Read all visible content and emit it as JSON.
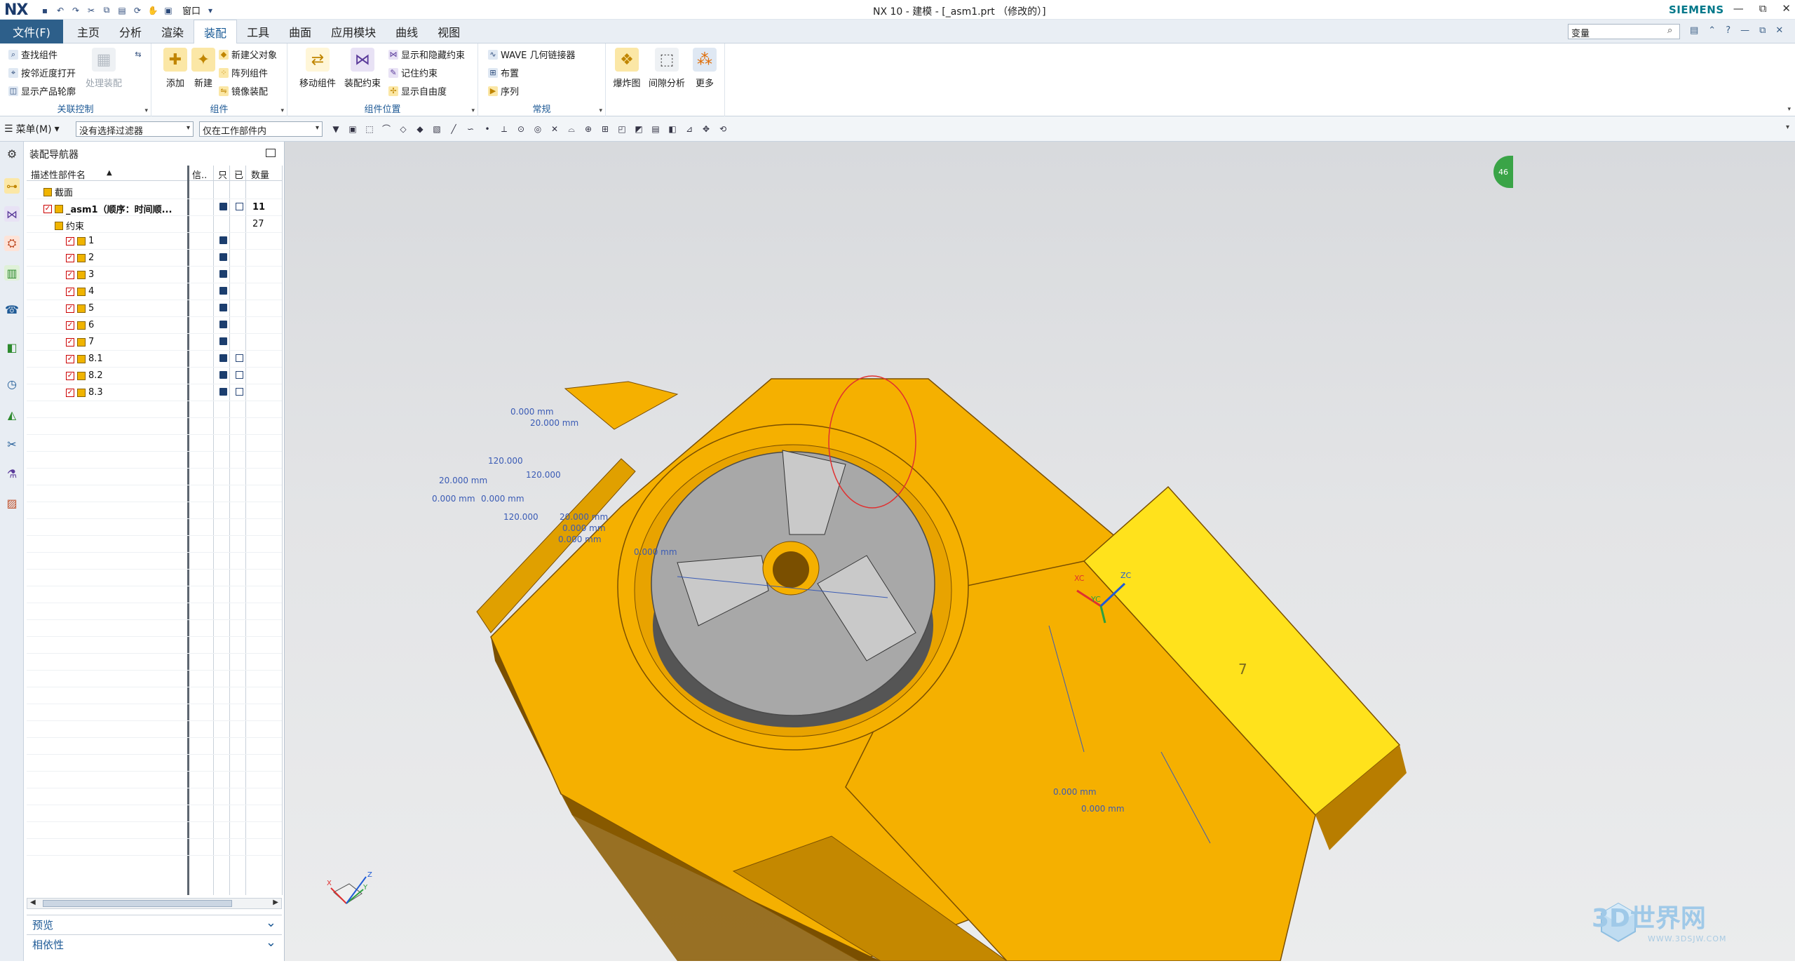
{
  "app": {
    "logo": "NX",
    "title": "NX 10 - 建模 - [_asm1.prt （修改的）]",
    "brand": "SIEMENS",
    "window_menu": "窗口",
    "window_controls": [
      "—",
      "⧉",
      "✕"
    ]
  },
  "tabs": {
    "file": "文件(F)",
    "items": [
      "主页",
      "分析",
      "渲染",
      "装配",
      "工具",
      "曲面",
      "应用模块",
      "曲线",
      "视图"
    ],
    "active": "装配",
    "search_value": "变量"
  },
  "ribbon": {
    "assoc_control": {
      "label": "关联控制",
      "cmds": [
        "查找组件",
        "按邻近度打开",
        "显示产品轮廓"
      ],
      "disabled_cmd": "处理装配"
    },
    "component": {
      "label": "组件",
      "big": [
        "添加",
        "新建"
      ],
      "cmds": [
        "新建父对象",
        "阵列组件",
        "镜像装配"
      ]
    },
    "component_position": {
      "label": "组件位置",
      "big": [
        "移动组件",
        "装配约束"
      ],
      "cmds": [
        "显示和隐藏约束",
        "记住约束",
        "显示自由度"
      ]
    },
    "general": {
      "label": "常规",
      "cmds": [
        "WAVE 几何链接器",
        "布置",
        "序列"
      ]
    },
    "more": {
      "big": [
        "爆炸图",
        "间隙分析",
        "更多"
      ]
    }
  },
  "toolbar2": {
    "menu_label": "菜单(M)",
    "filter_select": "没有选择过滤器",
    "scope_select": "仅在工作部件内"
  },
  "navigator": {
    "title": "装配导航器",
    "columns": [
      "描述性部件名",
      "信..",
      "只",
      "已",
      "数量"
    ],
    "rows": [
      {
        "name": "截面",
        "indent": 1,
        "qty": "",
        "save": false,
        "edit": false,
        "bold": false,
        "check": false
      },
      {
        "name": "_asm1（顺序：时间顺...",
        "indent": 1,
        "qty": "11",
        "save": true,
        "edit": true,
        "bold": true,
        "check": true
      },
      {
        "name": "约束",
        "indent": 2,
        "qty": "27",
        "save": false,
        "edit": false,
        "bold": false,
        "check": false
      },
      {
        "name": "1",
        "indent": 3,
        "qty": "",
        "save": true,
        "edit": false,
        "bold": false,
        "check": true
      },
      {
        "name": "2",
        "indent": 3,
        "qty": "",
        "save": true,
        "edit": false,
        "bold": false,
        "check": true
      },
      {
        "name": "3",
        "indent": 3,
        "qty": "",
        "save": true,
        "edit": false,
        "bold": false,
        "check": true
      },
      {
        "name": "4",
        "indent": 3,
        "qty": "",
        "save": true,
        "edit": false,
        "bold": false,
        "check": true
      },
      {
        "name": "5",
        "indent": 3,
        "qty": "",
        "save": true,
        "edit": false,
        "bold": false,
        "check": true
      },
      {
        "name": "6",
        "indent": 3,
        "qty": "",
        "save": true,
        "edit": false,
        "bold": false,
        "check": true
      },
      {
        "name": "7",
        "indent": 3,
        "qty": "",
        "save": true,
        "edit": false,
        "bold": false,
        "check": true
      },
      {
        "name": "8.1",
        "indent": 3,
        "qty": "",
        "save": true,
        "edit": true,
        "bold": false,
        "check": true
      },
      {
        "name": "8.2",
        "indent": 3,
        "qty": "",
        "save": true,
        "edit": true,
        "bold": false,
        "check": true
      },
      {
        "name": "8.3",
        "indent": 3,
        "qty": "",
        "save": true,
        "edit": true,
        "bold": false,
        "check": true
      }
    ],
    "accordion": [
      "预览",
      "相依性"
    ]
  },
  "viewport": {
    "dimensions": [
      "0.000 mm",
      "20.000 mm",
      "120.000",
      "120.000",
      "20.000 mm",
      "0.000 mm",
      "0.000 mm",
      "20.000 mm",
      "0.000 mm",
      "0.000 mm",
      "0.000 mm",
      "0.000 mm",
      "0.000 mm",
      "120.000"
    ],
    "csys": {
      "xc": "XC",
      "yc": "YC",
      "zc": "ZC"
    },
    "sketch_text": "7",
    "triad": {
      "x": "X",
      "y": "Y",
      "z": "Z"
    },
    "badge": "46",
    "watermark": "3D世界网",
    "watermark_sub": "WWW.3DSJW.COM"
  },
  "colors": {
    "file_tab": "#2d5f8a",
    "accent": "#1e5a96",
    "part_yellow": "#f5b000",
    "part_dark": "#7a4f00",
    "chuck_gray": "#a8a8a8",
    "annotation_red": "#e03030",
    "dim_blue": "#3a5bb5"
  }
}
